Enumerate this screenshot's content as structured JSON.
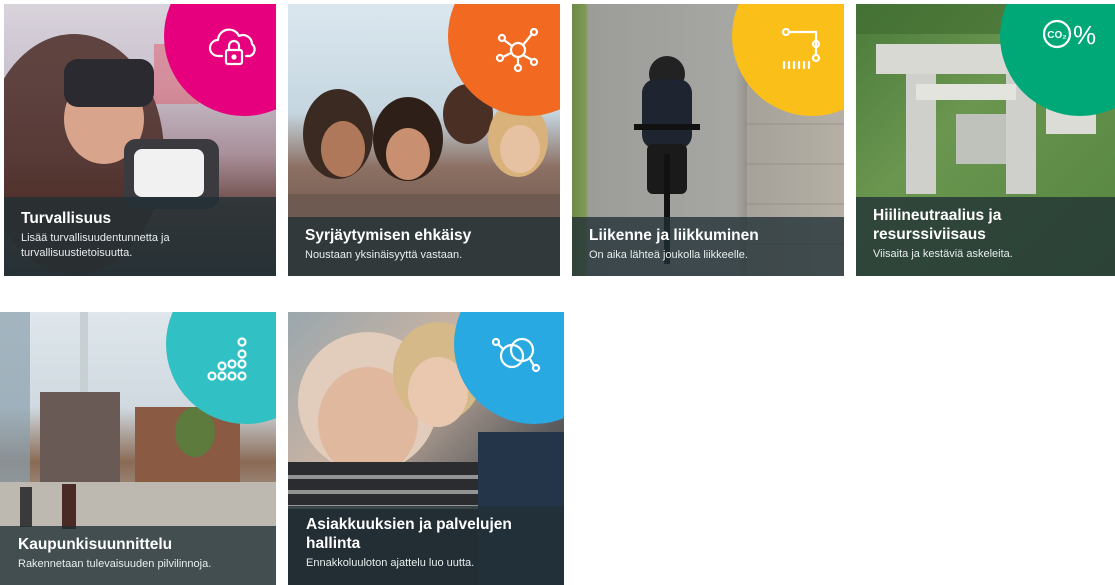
{
  "cards": [
    {
      "title": "Turvallisuus",
      "description": "Lisää turvallisuudentunnetta ja turvallisuustietoisuutta.",
      "icon": "cloud-lock-icon",
      "badge_color": "#e6007e"
    },
    {
      "title": "Syrjäytymisen ehkäisy",
      "description": "Noustaan yksinäisyyttä vastaan.",
      "icon": "network-node-icon",
      "badge_color": "#f26a21"
    },
    {
      "title": "Liikenne ja liikkuminen",
      "description": "On aika lähteä joukolla liikkeelle.",
      "icon": "route-icon",
      "badge_color": "#fbbf1a"
    },
    {
      "title": "Hiilineutraalius ja resurssiviisaus",
      "description": "Viisaita ja kestäviä askeleita.",
      "icon": "co2-percent-icon",
      "badge_color": "#00a878"
    },
    {
      "title": "Kaupunkisuunnittelu",
      "description": "Rakennetaan tulevaisuuden pilvilinnoja.",
      "icon": "dots-pyramid-icon",
      "badge_color": "#31c1c5"
    },
    {
      "title": "Asiakkuuksien ja palvelujen hallinta",
      "description": "Ennakkoluuloton ajattelu luo uutta.",
      "icon": "linked-circles-icon",
      "badge_color": "#29a9e1"
    }
  ],
  "co2_label": "CO₂",
  "percent_label": "%"
}
